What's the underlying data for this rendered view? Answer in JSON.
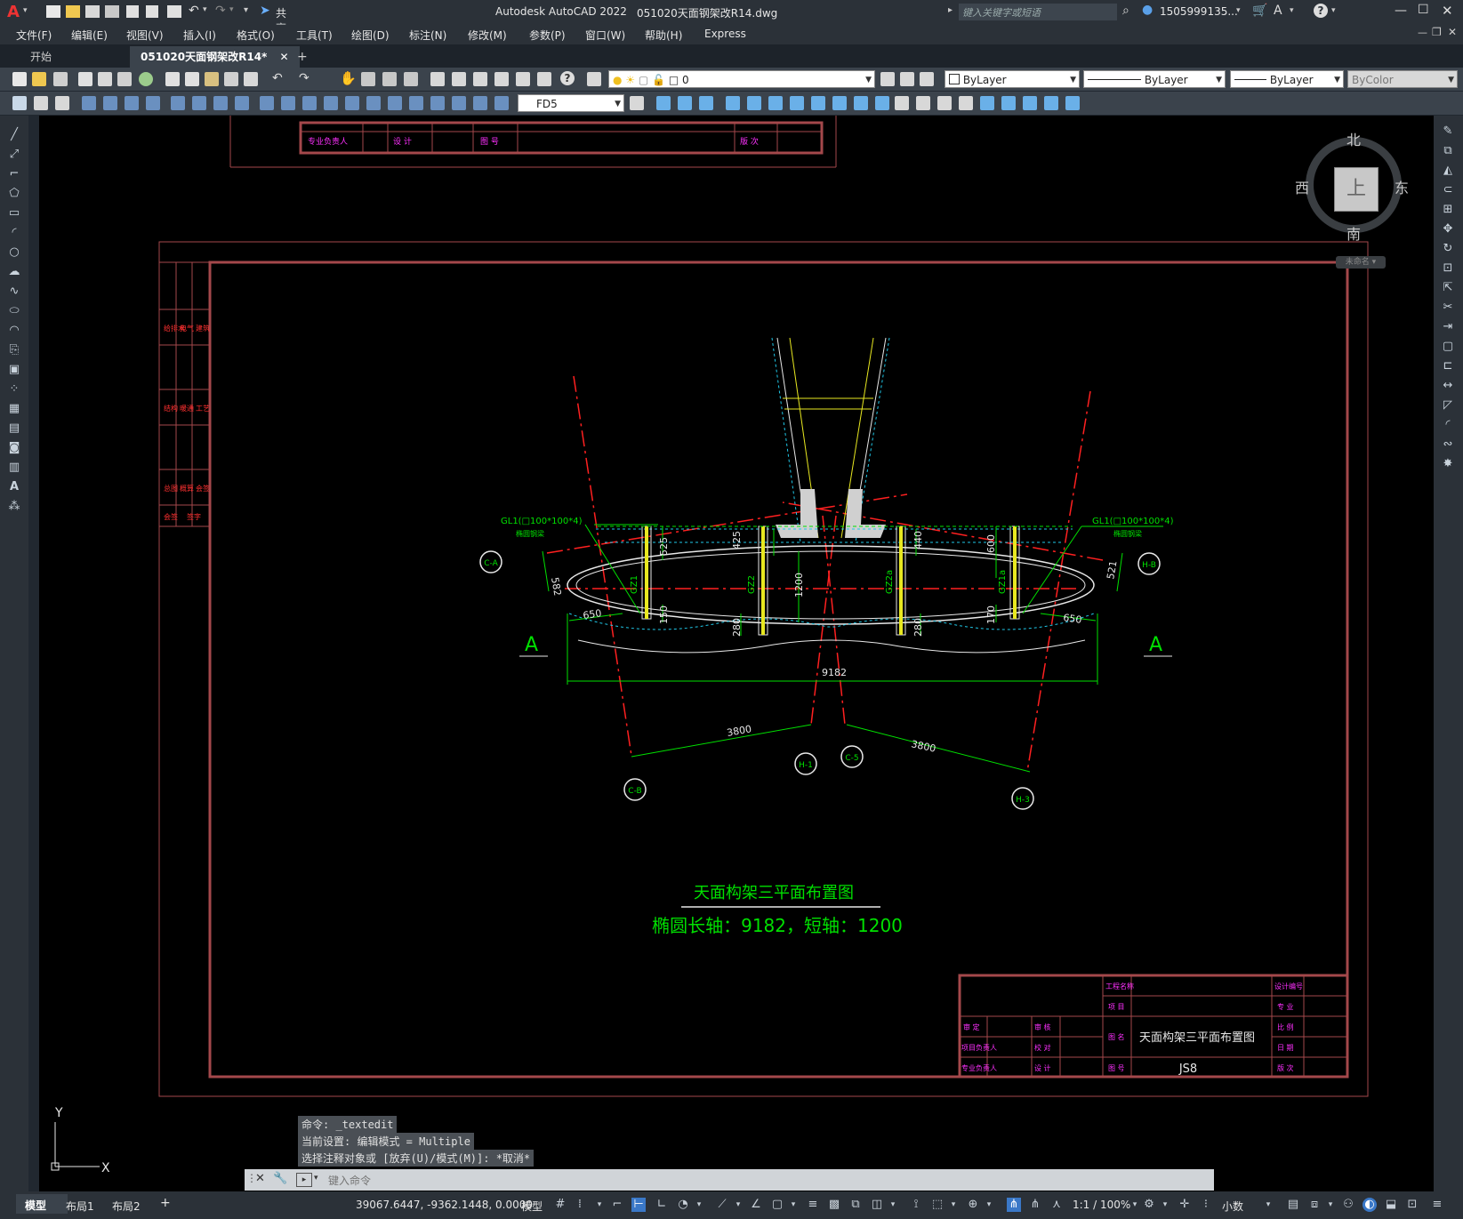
{
  "app": {
    "title": "Autodesk AutoCAD 2022",
    "filename": "051020天面钢架改R14.dwg",
    "share": "共享",
    "search_placeholder": "键入关键字或短语",
    "user": "1505999135...",
    "logo": "A"
  },
  "menu": [
    "文件(F)",
    "编辑(E)",
    "视图(V)",
    "插入(I)",
    "格式(O)",
    "工具(T)",
    "绘图(D)",
    "标注(N)",
    "修改(M)",
    "参数(P)",
    "窗口(W)",
    "帮助(H)",
    "Express"
  ],
  "tabs": {
    "start": "开始",
    "active": "051020天面钢架改R14*",
    "close": "✕",
    "add": "+"
  },
  "toolbar": {
    "layer_value": "0",
    "color": "ByLayer",
    "linetype": "ByLayer",
    "lineweight": "ByLayer",
    "plotstyle": "ByColor",
    "dimstyle": "FD5"
  },
  "viewcube": {
    "north": "北",
    "south": "南",
    "east": "东",
    "west": "西",
    "top": "上",
    "ucs": "未命名"
  },
  "drawing": {
    "title": "天面构架三平面布置图",
    "subtitle": "椭圆长轴：9182，短轴：1200",
    "beam_left": "GL1(□100*100*4)",
    "beam_left_sub": "椭圆钢梁",
    "beam_right": "GL1(□100*100*4)",
    "beam_right_sub": "椭圆钢梁",
    "section_left": "A",
    "section_right": "A",
    "dims": {
      "total": "9182",
      "left_3800": "3800",
      "right_3800": "3800",
      "d650_left": "650",
      "d650_right": "650",
      "d582": "582",
      "d521": "521",
      "d525": "525",
      "d425": "425",
      "d440": "440",
      "d600": "600",
      "d1200": "1200",
      "d150": "150",
      "d280a": "280",
      "d280b": "280",
      "d170": "170"
    },
    "members": [
      "GZ1",
      "GZ2",
      "GZ2a",
      "GZ1a"
    ],
    "axes": {
      "c_a": "C-A",
      "h_b": "H-B",
      "c_b": "C-B",
      "h_1": "H-1",
      "c_5": "C-5",
      "h_3": "H-3"
    },
    "top_block": {
      "c1": "专业负责人",
      "c2": "设 计",
      "c3": "图 号",
      "c4": "版 次"
    },
    "side_block": [
      "会签",
      "给排水",
      "电气",
      "建筑",
      "结构",
      "暖通",
      "工艺",
      "总图",
      "概算",
      "会签",
      "签字"
    ],
    "title_block": {
      "project_label": "工程名称",
      "item_label": "项 目",
      "design_no_label": "设计编号",
      "discipline_label": "专 业",
      "approve": "审 定",
      "review": "审 核",
      "drawing_name_label": "图 名",
      "drawing_name": "天面构架三平面布置图",
      "scale_label": "比 例",
      "project_lead": "项目负责人",
      "check": "校 对",
      "date_label": "日 期",
      "discipline_lead": "专业负责人",
      "design": "设 计",
      "drawing_no_label": "图 号",
      "drawing_no": "JS8",
      "revision_label": "版 次"
    }
  },
  "ucs_icon": {
    "x": "X",
    "y": "Y"
  },
  "command": {
    "lines": [
      "命令: _textedit",
      "当前设置: 编辑模式 = Multiple",
      "选择注释对象或 [放弃(U)/模式(M)]: *取消*"
    ],
    "placeholder": "键入命令"
  },
  "status": {
    "tab_model": "模型",
    "tab_layout1": "布局1",
    "tab_layout2": "布局2",
    "coords": "39067.6447, -9362.1448, 0.0000",
    "space": "模型",
    "scale": "1:1 / 100%",
    "units": "小数"
  },
  "colors": {
    "frame": "#a4484b",
    "green": "#00e000",
    "red": "#ff2020",
    "cyan": "#20c8e8",
    "yellow": "#e8e820",
    "white": "#e8e8e8",
    "magenta": "#ff30ff"
  }
}
